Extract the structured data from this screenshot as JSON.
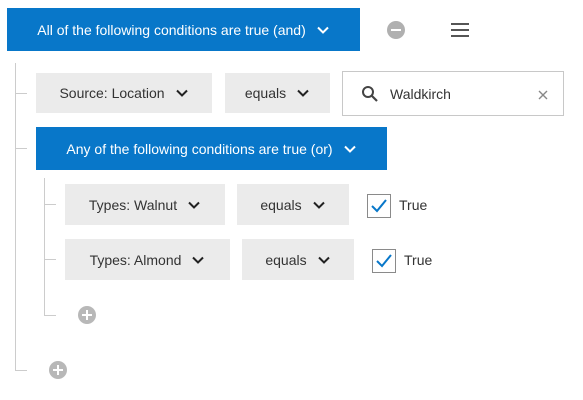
{
  "root": {
    "operator_label": "All of the following conditions are true (and)"
  },
  "condition_1": {
    "field_label": "Source: Location",
    "operator_label": "equals",
    "search_value": "Waldkirch"
  },
  "group": {
    "operator_label": "Any of the following conditions are true (or)",
    "conditions": [
      {
        "field_label": "Types: Walnut",
        "operator_label": "equals",
        "value_label": "True",
        "checked": true
      },
      {
        "field_label": "Types: Almond",
        "operator_label": "equals",
        "value_label": "True",
        "checked": true
      }
    ]
  },
  "icons": {
    "remove": "minus-circle-icon",
    "menu": "hamburger-menu-icon",
    "dropdown": "chevron-down-icon",
    "search": "search-icon",
    "clear": "close-icon",
    "check": "checkmark-icon",
    "add": "plus-circle-icon"
  },
  "colors": {
    "primary": "#0877c9",
    "button_gray": "#ebebeb",
    "tree_line": "#cccccc",
    "icon_gray": "#b8b8b8",
    "check": "#0877c9"
  }
}
